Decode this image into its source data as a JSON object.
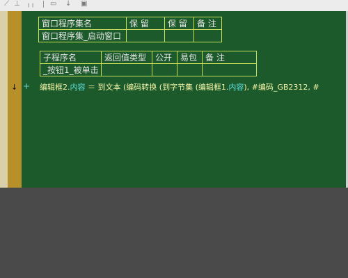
{
  "toolbar": {
    "icons": [
      "cut-icon",
      "fold-icon",
      "save-icon",
      "download-icon",
      "tab-icon"
    ],
    "glyphs": [
      "⟋",
      "⊥",
      "╷╷",
      "▭",
      "↓",
      "▣"
    ]
  },
  "window_table": {
    "headers": [
      "窗口程序集名",
      "保 留",
      "保 留",
      "备 注"
    ],
    "row": [
      "窗口程序集_启动窗口",
      "",
      "",
      ""
    ]
  },
  "sub_table": {
    "headers": [
      "子程序名",
      "返回值类型",
      "公开",
      "易包",
      "备 注"
    ],
    "row": [
      "_按钮1_被单击",
      "",
      "",
      "",
      ""
    ]
  },
  "code": {
    "line_marker": "↓",
    "fold_marker": "+",
    "target_obj": "编辑框2.",
    "target_prop": "内容",
    "assign": " ＝ 到文本 (编码转换 (到字节集 (编辑框1.",
    "source_prop": "内容",
    "tail": "), #编码_GB2312, #"
  },
  "colors": {
    "editor_bg": "#1c5a2b",
    "table_border": "#c8e05a",
    "gutter_gold": "#b8902a",
    "property": "#5fe0e0",
    "code_text": "#f4f4a8"
  }
}
